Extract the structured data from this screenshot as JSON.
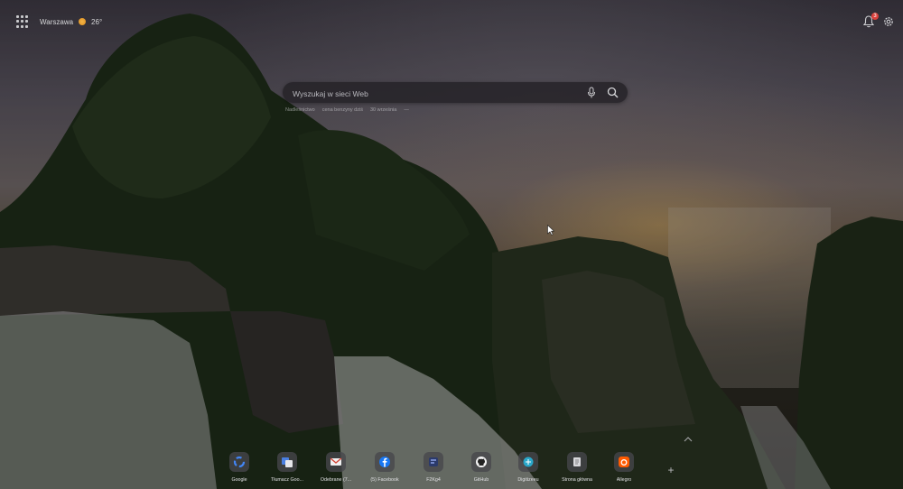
{
  "topbar": {
    "city": "Warszawa",
    "temperature": "26°",
    "notifications_count": "3"
  },
  "search": {
    "placeholder": "Wyszukaj w sieci Web",
    "trending": [
      "Nadleśnictwo",
      "cena benzyny dziś",
      "30 września",
      "—"
    ]
  },
  "dock": {
    "tiles": [
      {
        "label": "Google",
        "icon": "google-icon"
      },
      {
        "label": "Tłumacz Goo...",
        "icon": "translate-icon"
      },
      {
        "label": "Odebrane (7...",
        "icon": "gmail-icon"
      },
      {
        "label": "(5) Facebook",
        "icon": "facebook-icon"
      },
      {
        "label": "F2Kg4",
        "icon": "generic-site-icon"
      },
      {
        "label": "GitHub",
        "icon": "github-icon"
      },
      {
        "label": "Digitizeeu",
        "icon": "digitize-icon"
      },
      {
        "label": "Strona główna",
        "icon": "home-page-icon"
      },
      {
        "label": "Allegro",
        "icon": "allegro-icon"
      }
    ],
    "add_label": "+"
  },
  "colors": {
    "search_bg": "#232126",
    "badge": "#d9413c",
    "sun": "#e59a2a"
  }
}
